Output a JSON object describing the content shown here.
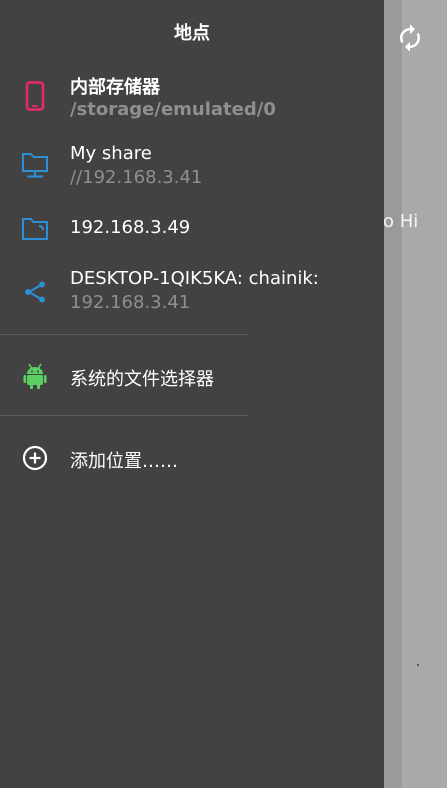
{
  "drawer": {
    "title": "地点",
    "locations": [
      {
        "name": "内部存储器",
        "path": "/storage/emulated/0"
      },
      {
        "name": "My share",
        "path": "//192.168.3.41"
      },
      {
        "name": "192.168.3.49"
      },
      {
        "name": "DESKTOP-1QIK5KA: chainik:",
        "path": "192.168.3.41"
      }
    ],
    "system_picker": "系统的文件选择器",
    "add_location": "添加位置……"
  },
  "background": {
    "partial_text": "o Hi"
  },
  "icons": {
    "internal": "phone-icon",
    "share": "folder-network-icon",
    "server": "folder-icon",
    "desktop": "share-icon",
    "system": "android-icon",
    "add": "add-circle-icon",
    "refresh": "refresh-icon"
  },
  "colors": {
    "drawer_bg": "#424242",
    "phone_icon": "#e8286e",
    "folder_icon": "#2f8fd6",
    "android_icon": "#5ccf63",
    "secondary_text": "#8f8f8f"
  }
}
